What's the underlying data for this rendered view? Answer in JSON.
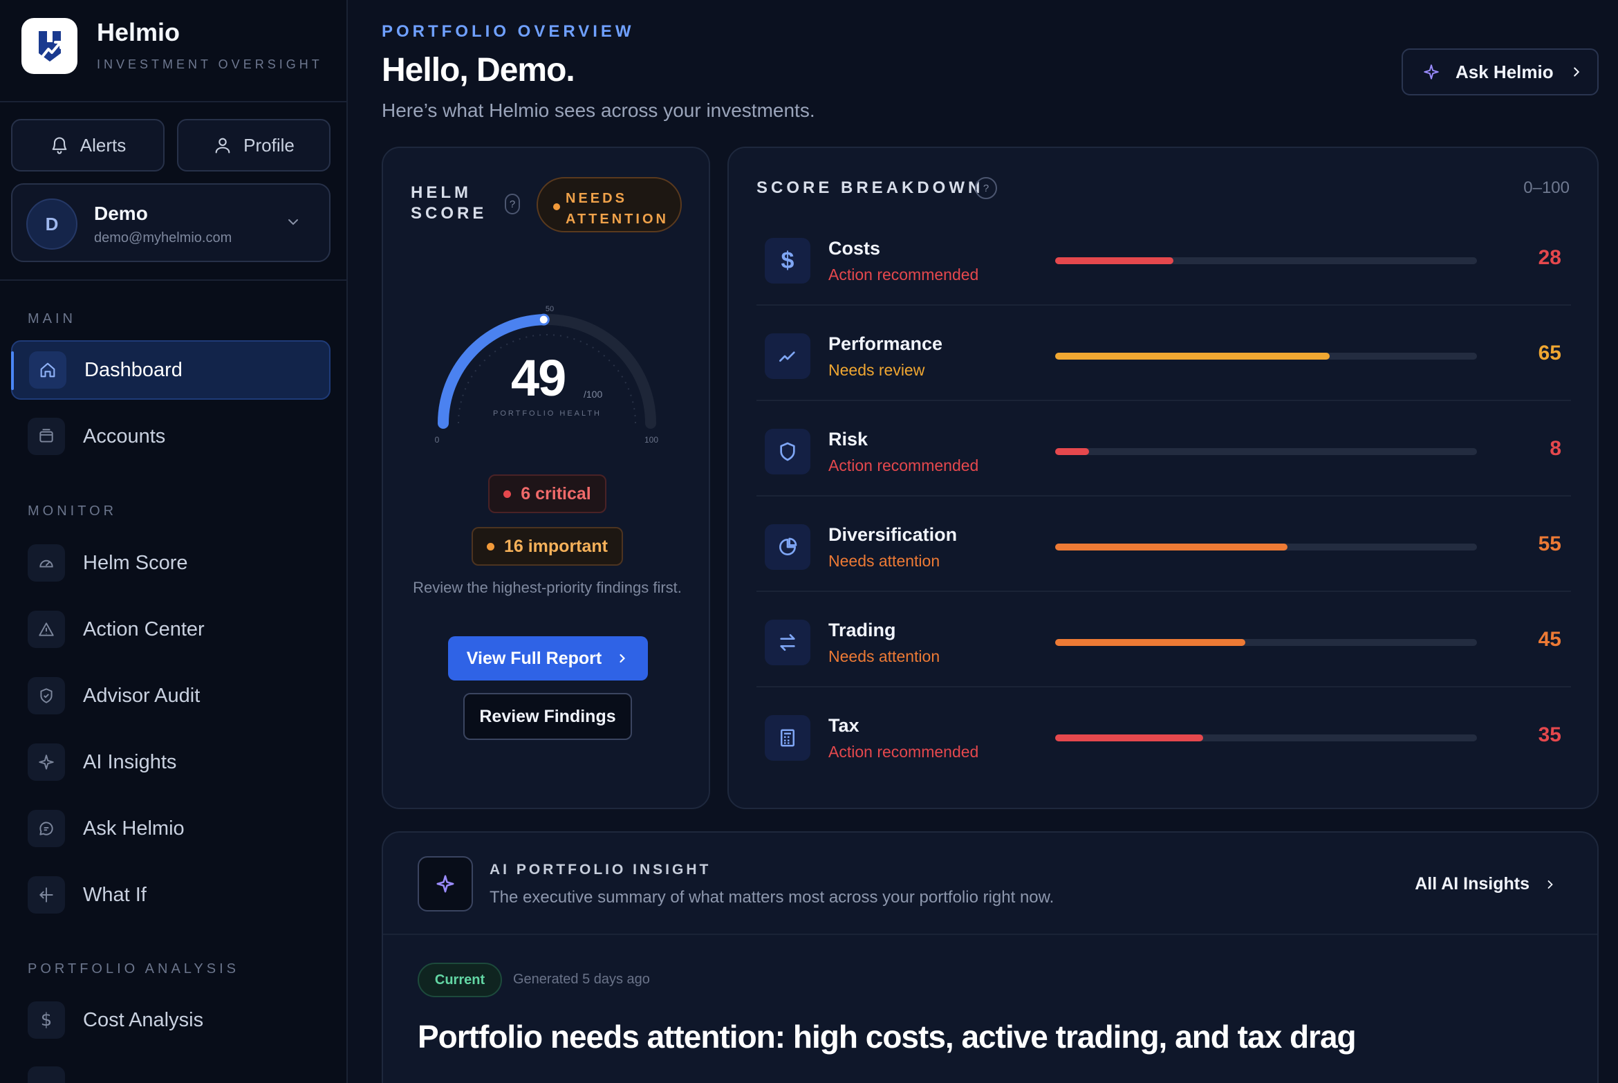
{
  "brand": {
    "name": "Helmio",
    "tagline": "INVESTMENT OVERSIGHT"
  },
  "top_buttons": {
    "alerts": "Alerts",
    "profile": "Profile"
  },
  "user": {
    "initial": "D",
    "name": "Demo",
    "email": "demo@myhelmio.com"
  },
  "sidebar": {
    "main_label": "MAIN",
    "main_items": [
      {
        "label": "Dashboard",
        "icon": "home-icon",
        "active": true
      },
      {
        "label": "Accounts",
        "icon": "wallet-icon"
      }
    ],
    "monitor_label": "MONITOR",
    "monitor_items": [
      {
        "label": "Helm Score",
        "icon": "gauge-icon"
      },
      {
        "label": "Action Center",
        "icon": "warning-icon"
      },
      {
        "label": "Advisor Audit",
        "icon": "shield-check-icon"
      },
      {
        "label": "AI Insights",
        "icon": "sparkle-icon"
      },
      {
        "label": "Ask Helmio",
        "icon": "chat-icon"
      },
      {
        "label": "What If",
        "icon": "split-icon"
      }
    ],
    "analysis_label": "PORTFOLIO ANALYSIS",
    "analysis_items": [
      {
        "label": "Cost Analysis",
        "icon": "dollar-icon"
      }
    ]
  },
  "header": {
    "eyebrow": "PORTFOLIO OVERVIEW",
    "greeting": "Hello, Demo.",
    "subtitle": "Here’s what Helmio sees across your investments.",
    "ask_button": "Ask Helmio"
  },
  "helm_score": {
    "title": "HELM SCORE",
    "help": "?",
    "status_line1": "NEEDS",
    "status_line2": "ATTENTION",
    "value": 49,
    "value_text": "49",
    "out_of": "/100",
    "caption": "PORTFOLIO HEALTH",
    "gauge_min": "0",
    "gauge_mid": "50",
    "gauge_max": "100",
    "critical": "6 critical",
    "important": "16 important",
    "hint": "Review the highest-priority findings first.",
    "primary_button": "View Full Report",
    "secondary_button": "Review Findings"
  },
  "score_breakdown": {
    "title": "SCORE BREAKDOWN",
    "help": "?",
    "range": "0–100",
    "rows": [
      {
        "name": "Costs",
        "status": "Action recommended",
        "value": 28,
        "value_text": "28",
        "color": "#e5484d",
        "icon": "dollar-icon"
      },
      {
        "name": "Performance",
        "status": "Needs review",
        "value": 65,
        "value_text": "65",
        "color": "#f0a732",
        "icon": "trend-icon"
      },
      {
        "name": "Risk",
        "status": "Action recommended",
        "value": 8,
        "value_text": "8",
        "color": "#e5484d",
        "icon": "shield-icon"
      },
      {
        "name": "Diversification",
        "status": "Needs attention",
        "value": 55,
        "value_text": "55",
        "color": "#ed7a35",
        "icon": "pie-icon"
      },
      {
        "name": "Trading",
        "status": "Needs attention",
        "value": 45,
        "value_text": "45",
        "color": "#ed7a35",
        "icon": "swap-icon"
      },
      {
        "name": "Tax",
        "status": "Action recommended",
        "value": 35,
        "value_text": "35",
        "color": "#e5484d",
        "icon": "receipt-icon"
      }
    ]
  },
  "ai_insight": {
    "eyebrow": "AI PORTFOLIO INSIGHT",
    "subtitle": "The executive summary of what matters most across your portfolio right now.",
    "link": "All AI Insights",
    "badge": "Current",
    "generated": "Generated 5 days ago",
    "headline": "Portfolio needs attention: high costs, active trading, and tax drag"
  },
  "colors": {
    "accent_blue": "#2f63e6",
    "critical_red": "#e5484d",
    "warning_orange": "#ed7a35",
    "review_amber": "#f0a732"
  }
}
